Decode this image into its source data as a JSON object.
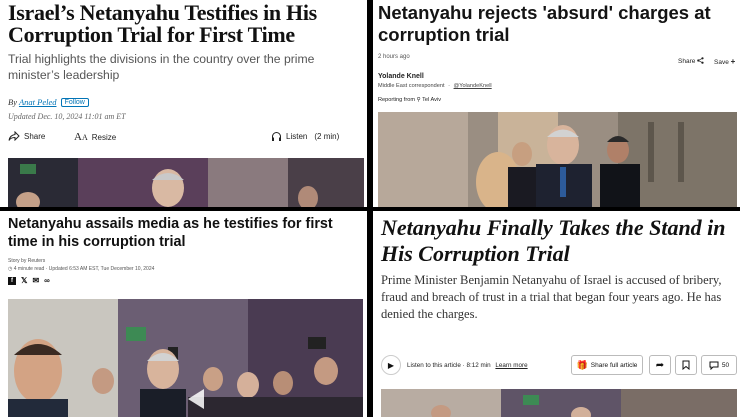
{
  "wsj": {
    "headline": "Israel’s Netanyahu Testifies in His Corruption Trial for First Time",
    "subhead": "Trial highlights the divisions in the country over the prime minister’s leadership",
    "by_prefix": "By",
    "author": "Anat Peled",
    "follow_label": "Follow",
    "updated": "Updated Dec. 10, 2024 11:01 am ET",
    "share_label": "Share",
    "resize_label": "Resize",
    "listen_label": "Listen",
    "listen_duration": "(2 min)"
  },
  "bbc": {
    "headline": "Netanyahu rejects 'absurd' charges at corruption trial",
    "time": "2 hours ago",
    "share_label": "Share",
    "save_label": "Save",
    "author": "Yolande Knell",
    "role": "Middle East correspondent",
    "handle": "@YolandeKnell",
    "reporting_prefix": "Reporting from",
    "location": "Tel Aviv"
  },
  "cnbc": {
    "headline": "Netanyahu assails media as he testifies for first time in his corruption trial",
    "source": "Story by Reuters",
    "meta": "4 minute read · Updated 6:53 AM EST, Tue December 10, 2024"
  },
  "nyt": {
    "headline": "Netanyahu Finally Takes the Stand in His Corruption Trial",
    "summary": "Prime Minister Benjamin Netanyahu of Israel is accused of bribery, fraud and breach of trust in a trial that began four years ago. He has denied the charges.",
    "listen_text": "Listen to this article · 8:12 min",
    "learn_more": "Learn more",
    "share_full_label": "Share full article",
    "comments_count": "50"
  }
}
